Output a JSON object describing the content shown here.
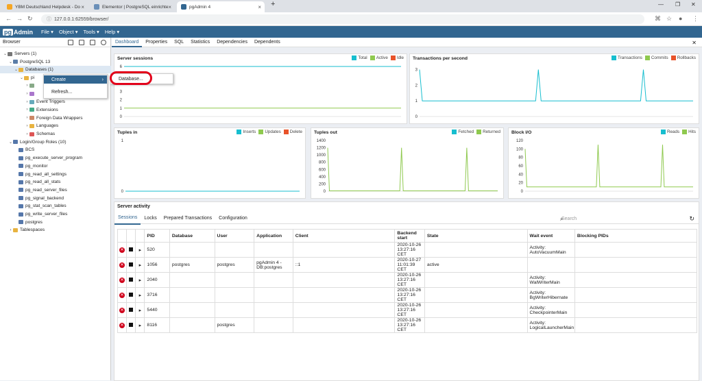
{
  "browser_tabs": [
    {
      "title": "YBM Deutschland Helpdesk - Do",
      "active": false
    },
    {
      "title": "Elementor | PostgreSQL einrichte",
      "active": false
    },
    {
      "title": "pgAdmin 4",
      "active": true
    }
  ],
  "url": "127.0.0.1:62559/browser/",
  "app": {
    "logo_a": "pg",
    "logo_b": "Admin",
    "menus": [
      "File ▾",
      "Object ▾",
      "Tools ▾",
      "Help ▾"
    ]
  },
  "left": {
    "title": "Browser",
    "tree": [
      {
        "label": "Servers (1)",
        "indent": 0,
        "tw": "⌄",
        "icon": "#777"
      },
      {
        "label": "PostgreSQL 13",
        "indent": 1,
        "tw": "⌄",
        "icon": "#5a7da8"
      },
      {
        "label": "Databases (1)",
        "indent": 2,
        "tw": "⌄",
        "icon": "#e8b340",
        "selected": true
      },
      {
        "label": "pi",
        "indent": 3,
        "tw": "⌄",
        "icon": "#e8b340"
      },
      {
        "label": "",
        "indent": 4,
        "tw": "›",
        "icon": "#8a8"
      },
      {
        "label": "",
        "indent": 4,
        "tw": "›",
        "icon": "#a7c"
      },
      {
        "label": "Event Triggers",
        "indent": 4,
        "tw": "›",
        "icon": "#6ab"
      },
      {
        "label": "Extensions",
        "indent": 4,
        "tw": "›",
        "icon": "#4a8"
      },
      {
        "label": "Foreign Data Wrappers",
        "indent": 4,
        "tw": "›",
        "icon": "#c86"
      },
      {
        "label": "Languages",
        "indent": 4,
        "tw": "›",
        "icon": "#e8b340"
      },
      {
        "label": "Schemas",
        "indent": 4,
        "tw": "›",
        "icon": "#d55"
      },
      {
        "label": "Login/Group Roles (10)",
        "indent": 1,
        "tw": "⌄",
        "icon": "#57a"
      },
      {
        "label": "BCS",
        "indent": 2,
        "tw": "",
        "icon": "#57a"
      },
      {
        "label": "pg_execute_server_program",
        "indent": 2,
        "tw": "",
        "icon": "#57a"
      },
      {
        "label": "pg_monitor",
        "indent": 2,
        "tw": "",
        "icon": "#57a"
      },
      {
        "label": "pg_read_all_settings",
        "indent": 2,
        "tw": "",
        "icon": "#57a"
      },
      {
        "label": "pg_read_all_stats",
        "indent": 2,
        "tw": "",
        "icon": "#57a"
      },
      {
        "label": "pg_read_server_files",
        "indent": 2,
        "tw": "",
        "icon": "#57a"
      },
      {
        "label": "pg_signal_backend",
        "indent": 2,
        "tw": "",
        "icon": "#57a"
      },
      {
        "label": "pg_stat_scan_tables",
        "indent": 2,
        "tw": "",
        "icon": "#57a"
      },
      {
        "label": "pg_write_server_files",
        "indent": 2,
        "tw": "",
        "icon": "#57a"
      },
      {
        "label": "postgres",
        "indent": 2,
        "tw": "",
        "icon": "#57a"
      },
      {
        "label": "Tablespaces",
        "indent": 1,
        "tw": "›",
        "icon": "#e8b340"
      }
    ]
  },
  "context_menu": {
    "create": "Create",
    "refresh": "Refresh...",
    "submenu_item": "Database..."
  },
  "main_tabs": [
    "Dashboard",
    "Properties",
    "SQL",
    "Statistics",
    "Dependencies",
    "Dependents"
  ],
  "colors": {
    "teal": "#17becf",
    "green": "#8fc94f",
    "orange": "#e8532a",
    "brand": "#326690"
  },
  "chart_data": [
    {
      "type": "line",
      "title": "Server sessions",
      "legend": [
        "Total",
        "Active",
        "Idle"
      ],
      "yticks": [
        "6",
        "5",
        "4",
        "3",
        "2",
        "1",
        "0"
      ],
      "ylim": [
        0,
        6
      ],
      "series": [
        {
          "name": "Total",
          "values": [
            6,
            6,
            6,
            6,
            6,
            6,
            6,
            6,
            6,
            6,
            6,
            6
          ]
        },
        {
          "name": "Active",
          "values": [
            1,
            1,
            1,
            1,
            1,
            1,
            1,
            1,
            1,
            1,
            1,
            1
          ]
        }
      ]
    },
    {
      "type": "line",
      "title": "Transactions per second",
      "legend": [
        "Transactions",
        "Commits",
        "Rollbacks"
      ],
      "yticks": [
        "3",
        "2",
        "1",
        "0"
      ],
      "ylim": [
        0,
        3.2
      ],
      "series": [
        {
          "name": "Transactions",
          "values": [
            3,
            1,
            1,
            1,
            1,
            1,
            1,
            1,
            1,
            1,
            1,
            1,
            1,
            1,
            1,
            1,
            1,
            1,
            1,
            1,
            1,
            1,
            1,
            1,
            1,
            1,
            1,
            1,
            1,
            1,
            1,
            1,
            1,
            1,
            1,
            1,
            1,
            1,
            1,
            1,
            1,
            1,
            1,
            3,
            1,
            1,
            1,
            1,
            1,
            1,
            1,
            1,
            1,
            1,
            1,
            1,
            1,
            1,
            1,
            1,
            1,
            1,
            1,
            1,
            1,
            1,
            1,
            1,
            1,
            1,
            1,
            1,
            1,
            1,
            1,
            1,
            1,
            1,
            1,
            1,
            1,
            3,
            1,
            1,
            1,
            1,
            1,
            1,
            1,
            1,
            1,
            1,
            1,
            1,
            1,
            1,
            1,
            1,
            1,
            1
          ]
        }
      ]
    },
    {
      "type": "line",
      "title": "Tuples in",
      "legend": [
        "Inserts",
        "Updates",
        "Delete"
      ],
      "yticks": [
        "1",
        "0"
      ],
      "ylim": [
        0,
        1
      ],
      "series": [
        {
          "name": "Inserts",
          "values": [
            0,
            0,
            0,
            0,
            0,
            0,
            0,
            0,
            0,
            0
          ]
        }
      ]
    },
    {
      "type": "line",
      "title": "Tuples out",
      "legend": [
        "Fetched",
        "Returned"
      ],
      "yticks": [
        "1400",
        "1200",
        "1000",
        "800",
        "600",
        "400",
        "200",
        "0"
      ],
      "ylim": [
        0,
        1400
      ],
      "series": [
        {
          "name": "Returned",
          "values": [
            1200,
            10,
            10,
            10,
            10,
            10,
            10,
            10,
            10,
            10,
            10,
            10,
            10,
            10,
            10,
            10,
            10,
            10,
            10,
            10,
            10,
            10,
            10,
            10,
            10,
            10,
            10,
            10,
            10,
            10,
            10,
            10,
            10,
            10,
            10,
            10,
            10,
            10,
            10,
            10,
            10,
            10,
            10,
            1200,
            10,
            10,
            10,
            10,
            10,
            10,
            10,
            10,
            10,
            10,
            10,
            10,
            10,
            10,
            10,
            10,
            10,
            10,
            10,
            10,
            10,
            10,
            10,
            10,
            10,
            10,
            10,
            10,
            10,
            10,
            10,
            10,
            10,
            10,
            10,
            10,
            10,
            1200,
            10,
            10,
            10,
            10,
            10,
            10,
            10,
            10,
            10,
            10,
            10,
            10,
            10,
            10,
            10,
            10,
            10,
            10
          ]
        }
      ]
    },
    {
      "type": "line",
      "title": "Block I/O",
      "legend": [
        "Reads",
        "Hits"
      ],
      "yticks": [
        "120",
        "100",
        "80",
        "60",
        "40",
        "20",
        "0"
      ],
      "ylim": [
        0,
        120
      ],
      "series": [
        {
          "name": "Hits",
          "values": [
            100,
            10,
            10,
            10,
            10,
            10,
            10,
            10,
            10,
            10,
            10,
            10,
            10,
            10,
            10,
            10,
            10,
            10,
            10,
            10,
            10,
            10,
            10,
            10,
            10,
            10,
            10,
            10,
            10,
            10,
            10,
            10,
            10,
            10,
            10,
            10,
            10,
            10,
            10,
            10,
            10,
            10,
            10,
            110,
            10,
            10,
            10,
            10,
            10,
            10,
            10,
            10,
            10,
            10,
            10,
            10,
            10,
            10,
            10,
            10,
            10,
            10,
            10,
            10,
            10,
            10,
            10,
            10,
            10,
            10,
            10,
            10,
            10,
            10,
            10,
            10,
            10,
            10,
            10,
            10,
            10,
            110,
            10,
            10,
            10,
            10,
            10,
            10,
            10,
            10,
            10,
            10,
            10,
            10,
            10,
            10,
            10,
            10,
            10,
            10
          ]
        }
      ]
    }
  ],
  "activity": {
    "title": "Server activity",
    "tabs": [
      "Sessions",
      "Locks",
      "Prepared Transactions",
      "Configuration"
    ],
    "search_placeholder": "Search",
    "columns": [
      "PID",
      "Database",
      "User",
      "Application",
      "Client",
      "Backend start",
      "State",
      "Wait event",
      "Blocking PIDs"
    ],
    "rows": [
      [
        "520",
        "",
        "",
        "",
        "",
        "2020-10-26 13:27:16 CET",
        "",
        "Activity: AutoVacuumMain",
        ""
      ],
      [
        "1056",
        "postgres",
        "postgres",
        "pgAdmin 4 - DB:postgres",
        "::1",
        "2020-10-27 11:01:39 CET",
        "active",
        "",
        ""
      ],
      [
        "2040",
        "",
        "",
        "",
        "",
        "2020-10-26 13:27:16 CET",
        "",
        "Activity: WalWriterMain",
        ""
      ],
      [
        "3716",
        "",
        "",
        "",
        "",
        "2020-10-26 13:27:16 CET",
        "",
        "Activity: BgWriterHibernate",
        ""
      ],
      [
        "5440",
        "",
        "",
        "",
        "",
        "2020-10-26 13:27:16 CET",
        "",
        "Activity: CheckpointerMain",
        ""
      ],
      [
        "8116",
        "",
        "postgres",
        "",
        "",
        "2020-10-26 13:27:16 CET",
        "",
        "Activity: LogicalLauncherMain",
        ""
      ]
    ]
  }
}
